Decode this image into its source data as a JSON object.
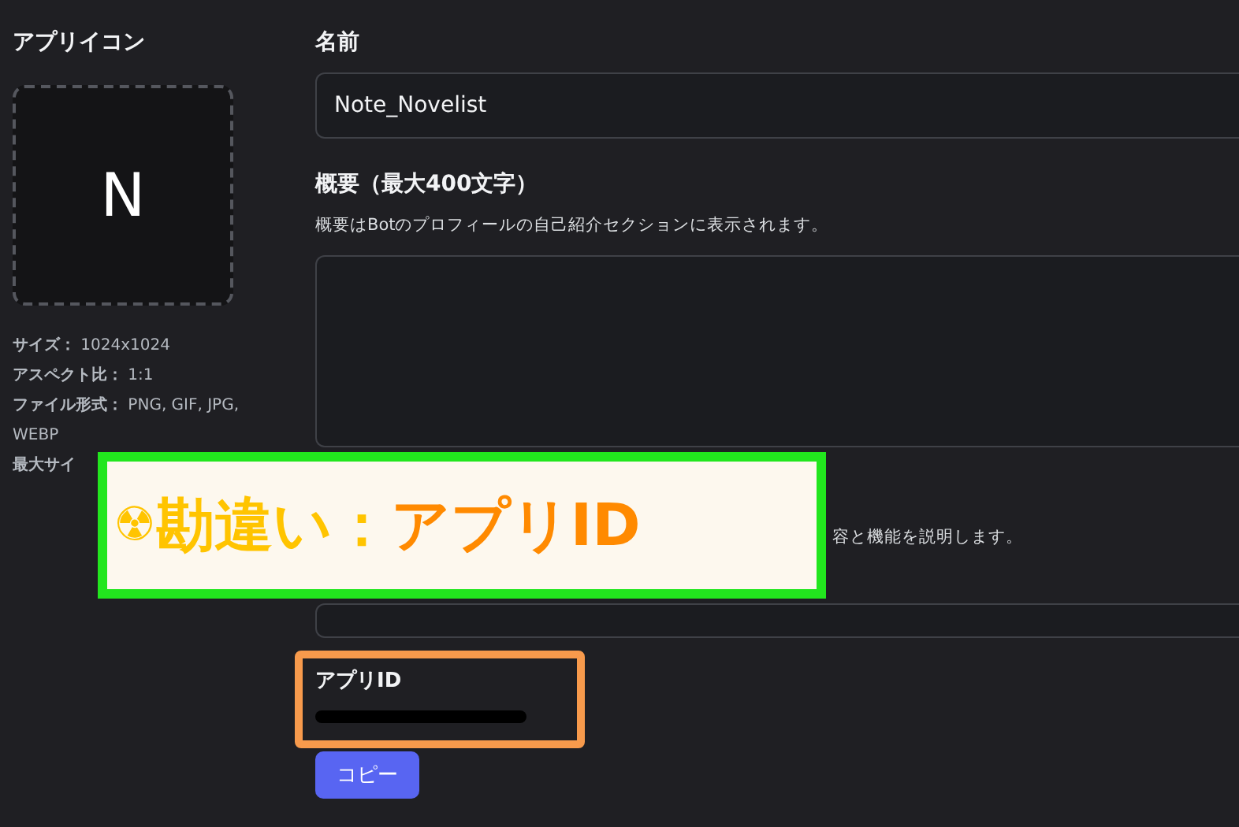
{
  "icon_section": {
    "title": "アプリイコン",
    "letter": "N",
    "specs": [
      {
        "label": "サイズ：",
        "value": "1024x1024"
      },
      {
        "label": "アスペクト比：",
        "value": "1:1"
      },
      {
        "label": "ファイル形式：",
        "value": "PNG, GIF, JPG, WEBP"
      },
      {
        "label": "最大サイ"
      }
    ]
  },
  "name_field": {
    "label": "名前",
    "value": "Note_Novelist"
  },
  "summary_field": {
    "label": "概要（最大400文字）",
    "help": "概要はBotのプロフィールの自己紹介セクションに表示されます。"
  },
  "description_field": {
    "help": "容と機能を説明します。"
  },
  "app_id": {
    "label": "アプリID",
    "redacted": true,
    "button": "コピー"
  },
  "annotation": {
    "symbol": "☢",
    "mistake": "勘違い：",
    "target": "アプリID"
  }
}
